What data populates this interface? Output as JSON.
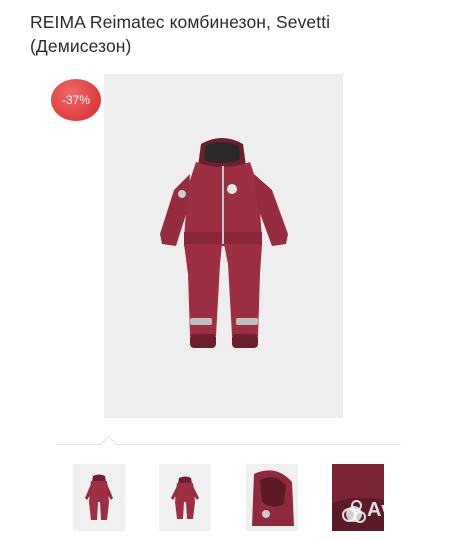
{
  "product": {
    "title_line1": "REIMA Reimatec комбинезон, Sevetti",
    "title_line2": "(Демисезон)"
  },
  "discount_badge": "-37%",
  "colors": {
    "badge": "#e03a3a",
    "garment": "#9c2f42",
    "garment_dark": "#6e1f2e",
    "reflective": "#bfbfbf"
  },
  "gallery": {
    "main_image": "burgundy-jumpsuit-front",
    "thumbnails": [
      {
        "label": "jumpsuit-front"
      },
      {
        "label": "jumpsuit-front-small"
      },
      {
        "label": "hood-detail"
      },
      {
        "label": "fabric-closeup"
      }
    ],
    "selected_index": 0
  },
  "watermark_text": "Avito"
}
